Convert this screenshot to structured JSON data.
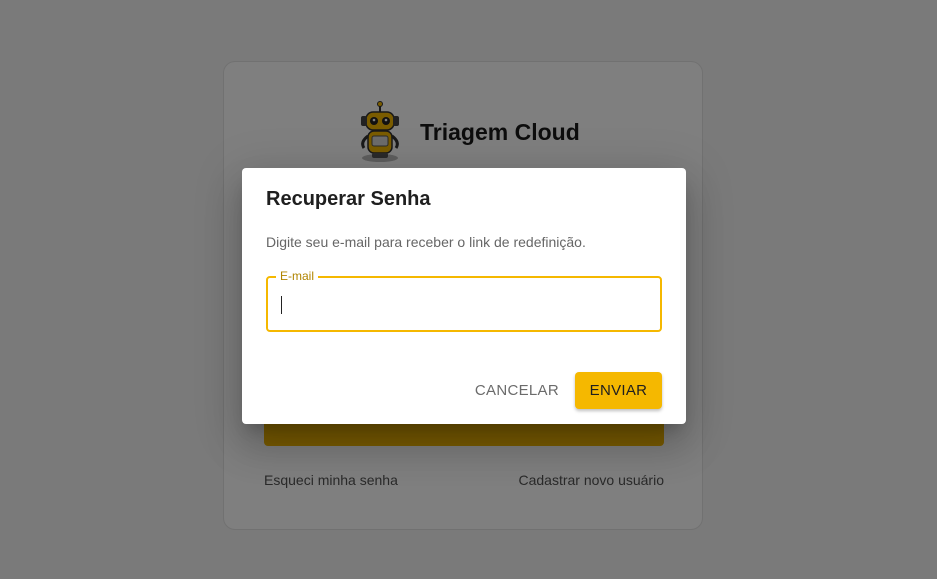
{
  "colors": {
    "accent": "#f5b800",
    "overlay": "rgba(0,0,0,0.5)",
    "page_background": "#f5f5f5"
  },
  "login": {
    "logo_icon": "robot-icon",
    "app_title": "Triagem Cloud",
    "forgot_password_link": "Esqueci minha senha",
    "register_link": "Cadastrar novo usuário"
  },
  "dialog": {
    "title": "Recuperar Senha",
    "description": "Digite seu e-mail para receber o link de redefinição.",
    "email_label": "E-mail",
    "email_value": "",
    "cancel_label": "CANCELAR",
    "send_label": "ENVIAR"
  }
}
